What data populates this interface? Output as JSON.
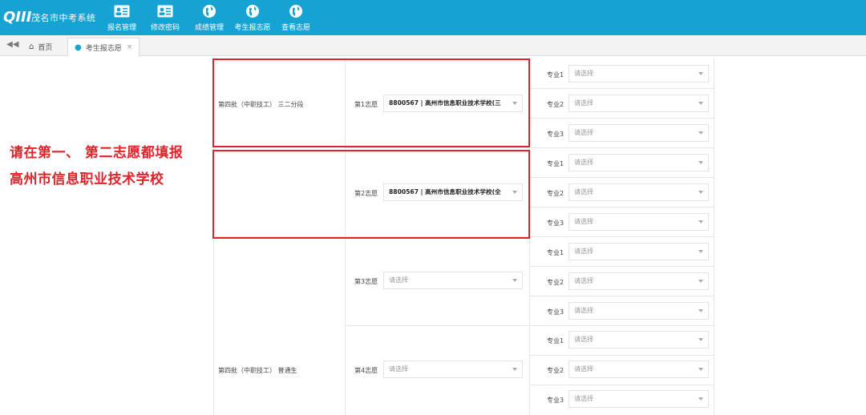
{
  "app": {
    "title": "茂名市中考系统",
    "logo_mark": "QIII"
  },
  "nav": [
    {
      "label": "报名管理",
      "icon": "id-card-icon"
    },
    {
      "label": "修改密码",
      "icon": "id-card-icon"
    },
    {
      "label": "成绩管理",
      "icon": "globe-icon"
    },
    {
      "label": "考生报志愿",
      "icon": "globe-icon"
    },
    {
      "label": "查看志愿",
      "icon": "globe-icon"
    }
  ],
  "tabs": {
    "home": "首页",
    "current": "考生报志愿",
    "close": "×"
  },
  "batches": [
    {
      "label": "第四批（中职技工） 三二分段"
    },
    {
      "label": "第四批（中职技工） 普通生"
    }
  ],
  "volunteers": [
    {
      "label": "第1志愿",
      "value": "8800567 | 高州市信息职业技术学校(三"
    },
    {
      "label": "第2志愿",
      "value": "8800567 | 高州市信息职业技术学校(全"
    },
    {
      "label": "第3志愿",
      "placeholder": "请选择"
    },
    {
      "label": "第4志愿",
      "placeholder": "请选择"
    }
  ],
  "majors": [
    {
      "label": "专业1",
      "placeholder": "请选择"
    },
    {
      "label": "专业2",
      "placeholder": "请选择"
    },
    {
      "label": "专业3",
      "placeholder": "请选择"
    },
    {
      "label": "专业1",
      "placeholder": "请选择"
    },
    {
      "label": "专业2",
      "placeholder": "请选择"
    },
    {
      "label": "专业3",
      "placeholder": "请选择"
    },
    {
      "label": "专业1",
      "placeholder": "请选择"
    },
    {
      "label": "专业2",
      "placeholder": "请选择"
    },
    {
      "label": "专业3",
      "placeholder": "请选择"
    },
    {
      "label": "专业1",
      "placeholder": "请选择"
    },
    {
      "label": "专业2",
      "placeholder": "请选择"
    },
    {
      "label": "专业3",
      "placeholder": "请选择"
    }
  ],
  "annotation": {
    "line1": "请在第一、 第二志愿都填报",
    "line2": "高州市信息职业技术学校",
    "color": "#e0232b"
  },
  "colors": {
    "header": "#17a2d4",
    "accent_red": "#e0232b"
  }
}
